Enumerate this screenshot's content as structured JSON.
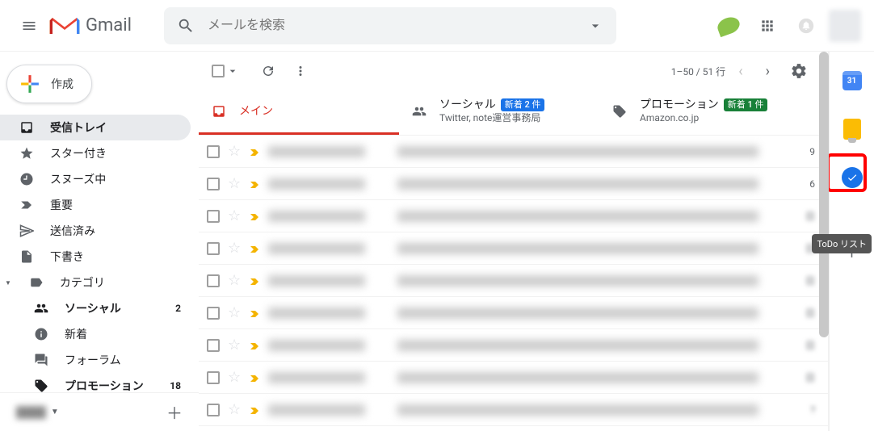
{
  "header": {
    "logo_text": "Gmail",
    "search_placeholder": "メールを検索"
  },
  "sidebar": {
    "compose_label": "作成",
    "items": [
      {
        "label": "受信トレイ",
        "icon": "inbox",
        "active": true
      },
      {
        "label": "スター付き",
        "icon": "star"
      },
      {
        "label": "スヌーズ中",
        "icon": "clock"
      },
      {
        "label": "重要",
        "icon": "imp"
      },
      {
        "label": "送信済み",
        "icon": "send"
      },
      {
        "label": "下書き",
        "icon": "draft"
      },
      {
        "label": "カテゴリ",
        "icon": "label",
        "caret": true
      },
      {
        "label": "ソーシャル",
        "icon": "people",
        "sub": true,
        "bold": true,
        "count": "2"
      },
      {
        "label": "新着",
        "icon": "info",
        "sub": true
      },
      {
        "label": "フォーラム",
        "icon": "forum",
        "sub": true
      },
      {
        "label": "プロモーション",
        "icon": "tag",
        "sub": true,
        "bold": true,
        "count": "18"
      }
    ]
  },
  "toolbar": {
    "pagination": "1–50 / 51 行"
  },
  "tabs": [
    {
      "label": "メイン",
      "active": true
    },
    {
      "label": "ソーシャル",
      "badge": "新着 2 件",
      "badge_color": "blue",
      "sub": "Twitter, note運営事務局"
    },
    {
      "label": "プロモーション",
      "badge": "新着 1 件",
      "badge_color": "green",
      "sub": "Amazon.co.jp"
    }
  ],
  "messages": [
    {
      "date": "9"
    },
    {
      "date": "6"
    },
    {
      "date": "日"
    },
    {
      "date": "日"
    },
    {
      "date": "日"
    },
    {
      "date": "日"
    },
    {
      "date": "日"
    },
    {
      "date": "日"
    },
    {
      "date": "?"
    }
  ],
  "sidepanel": {
    "calendar_day": "31",
    "tooltip": "ToDo リスト"
  }
}
